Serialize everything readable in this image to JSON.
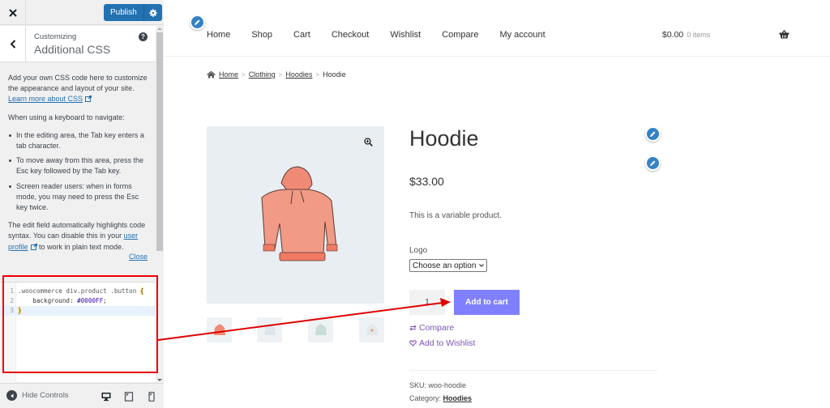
{
  "sidebar": {
    "close_icon": "close-icon",
    "publish_label": "Publish",
    "publish_settings_icon": "gear-icon",
    "back_icon": "chevron-left-icon",
    "customizing_label": "Customizing",
    "section_title": "Additional CSS",
    "help_icon": "question-icon",
    "description": {
      "intro": "Add your own CSS code here to customize the appearance and layout of your site.",
      "learn_more_link": "Learn more about CSS",
      "keyboard_heading": "When using a keyboard to navigate:",
      "bullets": [
        "In the editing area, the Tab key enters a tab character.",
        "To move away from this area, press the Esc key followed by the Tab key.",
        "Screen reader users: when in forms mode, you may need to press the Esc key twice."
      ],
      "syntax_text_before": "The edit field automatically highlights code syntax. You can disable this in your ",
      "user_profile_link": "user profile",
      "syntax_text_after": " to work in plain text mode.",
      "close_link": "Close"
    },
    "code_editor": {
      "lines": [
        {
          "number": "1",
          "selector": ".woocommerce div.product .button ",
          "brace": "{"
        },
        {
          "number": "2",
          "property": "    background: ",
          "value": "#0000FF",
          "end": ";"
        },
        {
          "number": "3",
          "brace": "}"
        }
      ]
    },
    "footer": {
      "hide_controls_label": "Hide Controls",
      "devices": [
        "desktop",
        "tablet",
        "mobile"
      ]
    }
  },
  "preview": {
    "nav": [
      "Home",
      "Shop",
      "Cart",
      "Checkout",
      "Wishlist",
      "Compare",
      "My account"
    ],
    "cart": {
      "total": "$0.00",
      "count": "0 items"
    },
    "breadcrumb": {
      "links": [
        "Home",
        "Clothing",
        "Hoodies"
      ],
      "current": "Hoodie",
      "separator": ">"
    },
    "product": {
      "title": "Hoodie",
      "price": "$33.00",
      "short_description": "This is a variable product.",
      "attribute_label": "Logo",
      "attribute_select_value": "Choose an option",
      "quantity": "1",
      "add_to_cart_label": "Add to cart",
      "add_to_cart_color": "#8080ff",
      "compare_label": "Compare",
      "wishlist_label": "Add to Wishlist",
      "sku_label": "SKU:",
      "sku_value": "woo-hoodie",
      "category_label": "Category:",
      "category_value": "Hoodies",
      "thumbnails": [
        "hoodie-orange",
        "hoodie-white-light",
        "hoodie-green",
        "hoodie-white-logo"
      ]
    }
  },
  "colors": {
    "accent": "#2271b1",
    "annotation": "#e00000",
    "link_purple": "#7f54b3"
  }
}
